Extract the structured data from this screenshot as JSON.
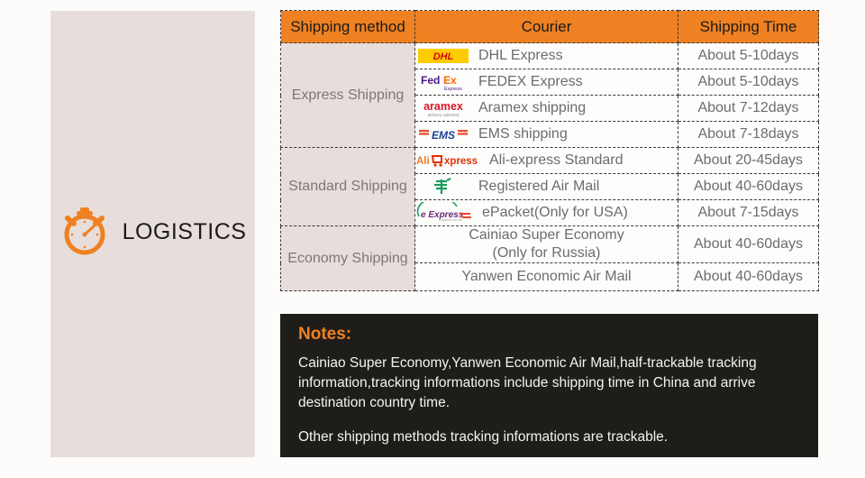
{
  "left_panel": {
    "icon": "stopwatch-icon",
    "label": "LOGISTICS",
    "accent_color": "#ef8122",
    "background_color": "#e7dedb"
  },
  "table": {
    "header": {
      "method": "Shipping method",
      "courier": "Courier",
      "time": "Shipping Time",
      "background_color": "#ef8122"
    },
    "groups": [
      {
        "method": "Express Shipping",
        "rows": [
          {
            "logo": "dhl-logo",
            "courier": "DHL Express",
            "time": "About 5-10days"
          },
          {
            "logo": "fedex-logo",
            "courier": "FEDEX Express",
            "time": "About 5-10days"
          },
          {
            "logo": "aramex-logo",
            "courier": "Aramex shipping",
            "time": "About 7-12days"
          },
          {
            "logo": "ems-logo",
            "courier": "EMS shipping",
            "time": "About 7-18days"
          }
        ]
      },
      {
        "method": "Standard Shipping",
        "rows": [
          {
            "logo": "aliexpress-logo",
            "courier": "Ali-express Standard",
            "time": "About 20-45days"
          },
          {
            "logo": "china-post-logo",
            "courier": "Registered Air Mail",
            "time": "About 40-60days"
          },
          {
            "logo": "eexpress-logo",
            "courier": "ePacket(Only for USA)",
            "time": "About 7-15days"
          }
        ]
      },
      {
        "method": "Economy Shipping",
        "rows": [
          {
            "logo": "",
            "courier": "Cainiao Super Economy",
            "courier_line2": "(Only for Russia)",
            "time": "About 40-60days"
          },
          {
            "logo": "",
            "courier": "Yanwen Economic Air Mail",
            "time": "About 40-60days"
          }
        ]
      }
    ]
  },
  "notes": {
    "title": "Notes:",
    "paragraph1": "Cainiao Super Economy,Yanwen Economic Air Mail,half-trackable tracking information,tracking informations include shipping time in China and arrive destination country time.",
    "paragraph2": "Other shipping methods tracking informations are trackable.",
    "title_color": "#ef8122",
    "background_color": "#1f1d1a"
  }
}
